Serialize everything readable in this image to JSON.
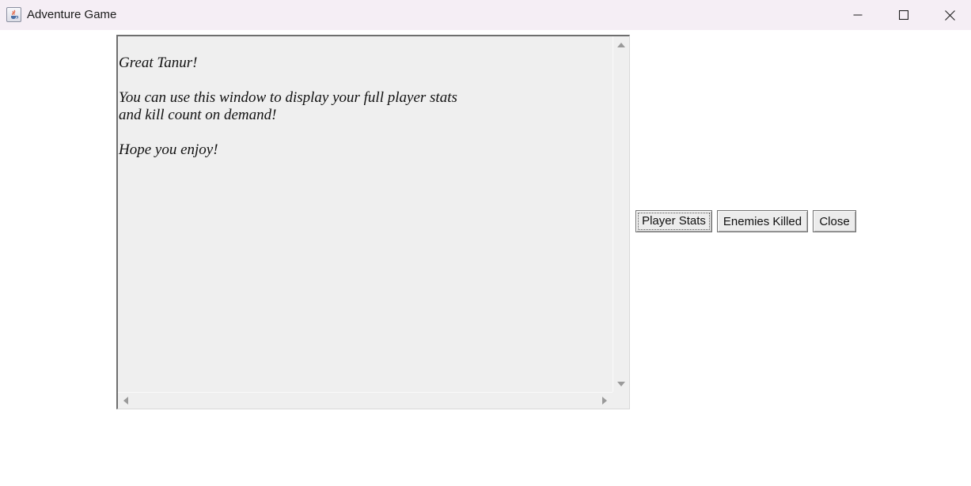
{
  "window": {
    "title": "Adventure Game",
    "app_icon": "java-cup-icon",
    "controls": [
      "minimize-icon",
      "maximize-icon",
      "close-icon"
    ]
  },
  "text_area": {
    "lines": [
      "Great Tanur!",
      "",
      "You can use this window to display your full player stats",
      "and kill count on demand!",
      "",
      "Hope you enjoy!"
    ]
  },
  "buttons": {
    "player_stats": "Player Stats",
    "enemies_killed": "Enemies Killed",
    "close": "Close"
  },
  "colors": {
    "titlebar_bg": "#f5eef5",
    "textarea_bg": "#efefef",
    "button_bg": "#ececec"
  }
}
